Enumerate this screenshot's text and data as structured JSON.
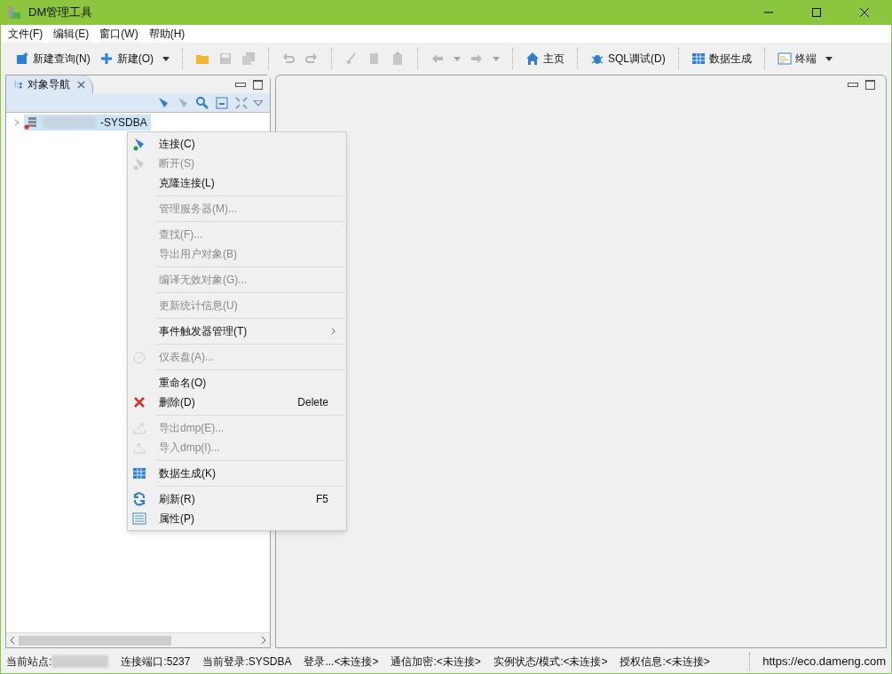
{
  "window": {
    "title": "DM管理工具"
  },
  "menu_bar": [
    "文件(F)",
    "编辑(E)",
    "窗口(W)",
    "帮助(H)"
  ],
  "toolbar": [
    {
      "kind": "button",
      "label": "新建查询(N)",
      "disabled": false
    },
    {
      "kind": "button",
      "label": "新建(O)",
      "disabled": false
    },
    {
      "kind": "dropdown",
      "disabled": false
    },
    {
      "kind": "separator"
    },
    {
      "kind": "icon",
      "disabled": false
    },
    {
      "kind": "icon",
      "disabled": true
    },
    {
      "kind": "icon",
      "disabled": true
    },
    {
      "kind": "separator"
    },
    {
      "kind": "icon",
      "disabled": true
    },
    {
      "kind": "icon",
      "disabled": true
    },
    {
      "kind": "separator"
    },
    {
      "kind": "icon",
      "disabled": true
    },
    {
      "kind": "icon",
      "disabled": true
    },
    {
      "kind": "icon",
      "disabled": true
    },
    {
      "kind": "separator"
    },
    {
      "kind": "icon",
      "disabled": true
    },
    {
      "kind": "dropdown",
      "disabled": true
    },
    {
      "kind": "icon",
      "disabled": true
    },
    {
      "kind": "dropdown",
      "disabled": true
    },
    {
      "kind": "separator"
    },
    {
      "kind": "button",
      "label": "主页",
      "disabled": false
    },
    {
      "kind": "separator"
    },
    {
      "kind": "button",
      "label": "SQL调试(D)",
      "disabled": false
    },
    {
      "kind": "separator"
    },
    {
      "kind": "button",
      "label": "数据生成",
      "disabled": false
    },
    {
      "kind": "separator"
    },
    {
      "kind": "button",
      "label": "终端",
      "disabled": false
    },
    {
      "kind": "dropdown",
      "disabled": false
    }
  ],
  "navigator": {
    "tab": {
      "label": "对象导航",
      "selected": true
    },
    "tree": [
      {
        "label": "-SYSDBA",
        "selected": true,
        "expanded": false
      }
    ]
  },
  "context_menu": [
    {
      "kind": "item",
      "label": "连接(C)",
      "disabled": false
    },
    {
      "kind": "item",
      "label": "断开(S)",
      "disabled": true
    },
    {
      "kind": "item",
      "label": "克隆连接(L)",
      "disabled": false
    },
    {
      "kind": "separator"
    },
    {
      "kind": "item",
      "label": "管理服务器(M)...",
      "disabled": true
    },
    {
      "kind": "separator"
    },
    {
      "kind": "item",
      "label": "查找(F)...",
      "disabled": true
    },
    {
      "kind": "item",
      "label": "导出用户对象(B)",
      "disabled": true
    },
    {
      "kind": "separator"
    },
    {
      "kind": "item",
      "label": "编译无效对象(G)...",
      "disabled": true
    },
    {
      "kind": "separator"
    },
    {
      "kind": "item",
      "label": "更新统计信息(U)",
      "disabled": true
    },
    {
      "kind": "separator"
    },
    {
      "kind": "item",
      "label": "事件触发器管理(T)",
      "disabled": false,
      "submenu": true
    },
    {
      "kind": "separator"
    },
    {
      "kind": "item",
      "label": "仪表盘(A)...",
      "disabled": true
    },
    {
      "kind": "separator"
    },
    {
      "kind": "item",
      "label": "重命名(O)",
      "disabled": false
    },
    {
      "kind": "item",
      "label": "删除(D)",
      "disabled": false,
      "shortcut": "Delete"
    },
    {
      "kind": "separator"
    },
    {
      "kind": "item",
      "label": "导出dmp(E)...",
      "disabled": true
    },
    {
      "kind": "item",
      "label": "导入dmp(I)...",
      "disabled": true
    },
    {
      "kind": "separator"
    },
    {
      "kind": "item",
      "label": "数据生成(K)",
      "disabled": false
    },
    {
      "kind": "separator"
    },
    {
      "kind": "item",
      "label": "刷新(R)",
      "disabled": false,
      "shortcut": "F5"
    },
    {
      "kind": "item",
      "label": "属性(P)",
      "disabled": false
    }
  ],
  "status_bar": {
    "fields": [
      "当前站点:",
      "连接端口:5237",
      "当前登录:SYSDBA",
      "登录...<未连接>",
      "通信加密:<未连接>",
      "实例状态/模式:<未连接>",
      "授权信息:<未连接>"
    ],
    "url": "https://eco.dameng.com"
  }
}
